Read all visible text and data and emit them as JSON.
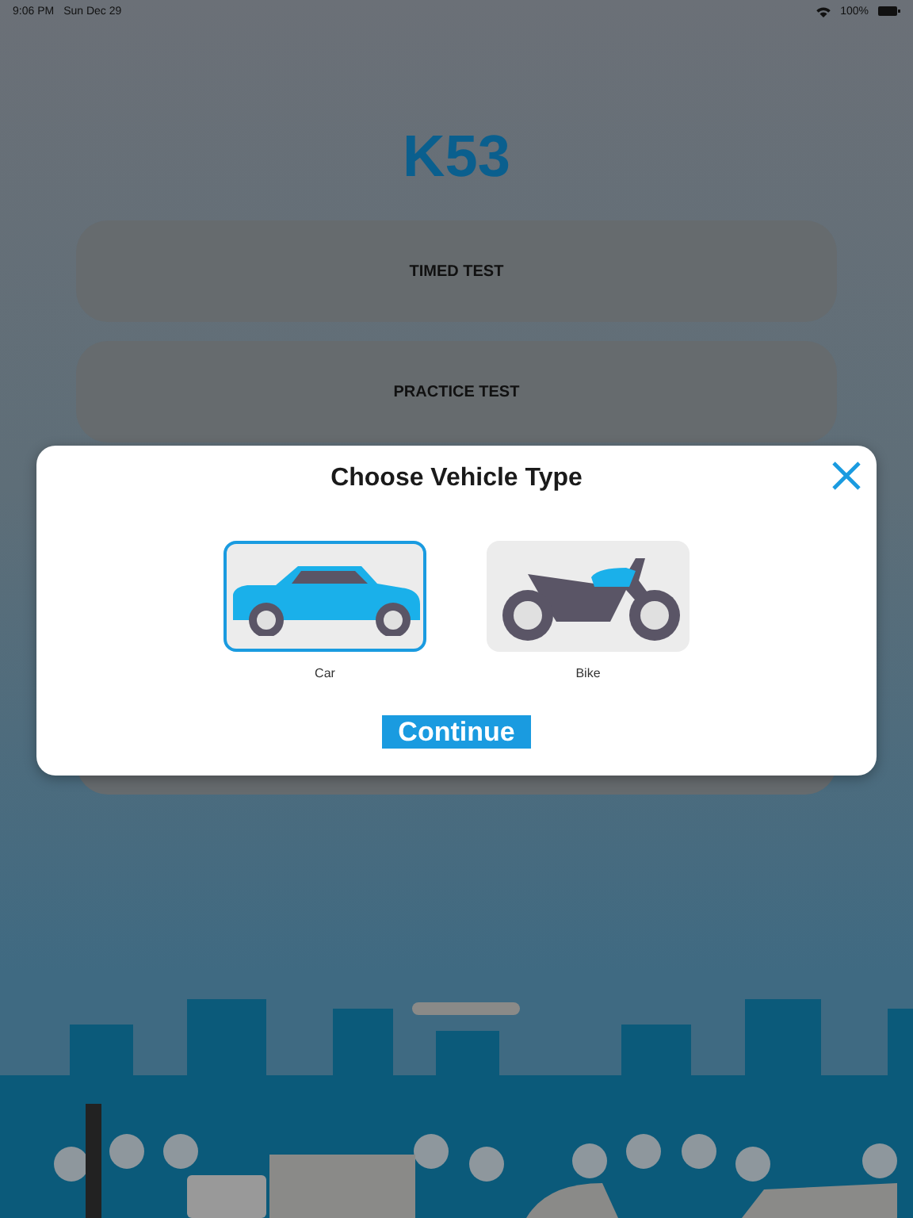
{
  "status_bar": {
    "time": "9:06 PM",
    "date": "Sun Dec 29",
    "battery": "100%"
  },
  "title": "K53",
  "menu": [
    {
      "kind": "labeled",
      "label": "TIMED TEST"
    },
    {
      "kind": "labeled",
      "label": "PRACTICE TEST"
    },
    {
      "kind": "covered"
    }
  ],
  "dialog": {
    "title": "Choose Vehicle Type",
    "vehicles": [
      {
        "kind": "car",
        "label": "Car",
        "selected": true
      },
      {
        "kind": "bike",
        "label": "Bike",
        "selected": false
      }
    ],
    "button": "Continue"
  }
}
